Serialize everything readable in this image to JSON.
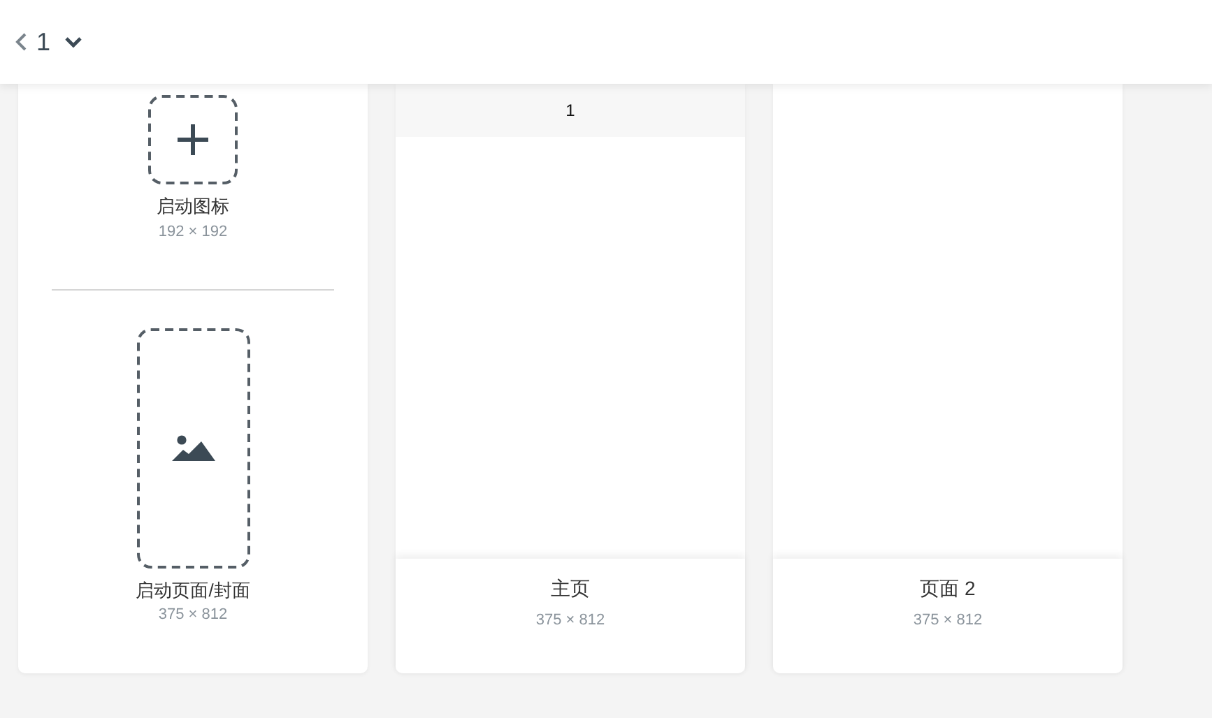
{
  "header": {
    "page_number": "1"
  },
  "launch_panel": {
    "icon_slot": {
      "label": "启动图标",
      "size": "192 × 192"
    },
    "splash_slot": {
      "label": "启动页面/封面",
      "size": "375 × 812"
    }
  },
  "pages": [
    {
      "preview_header": "1",
      "name": "主页",
      "size": "375 × 812"
    },
    {
      "name": "页面 2",
      "size": "375 × 812"
    }
  ]
}
